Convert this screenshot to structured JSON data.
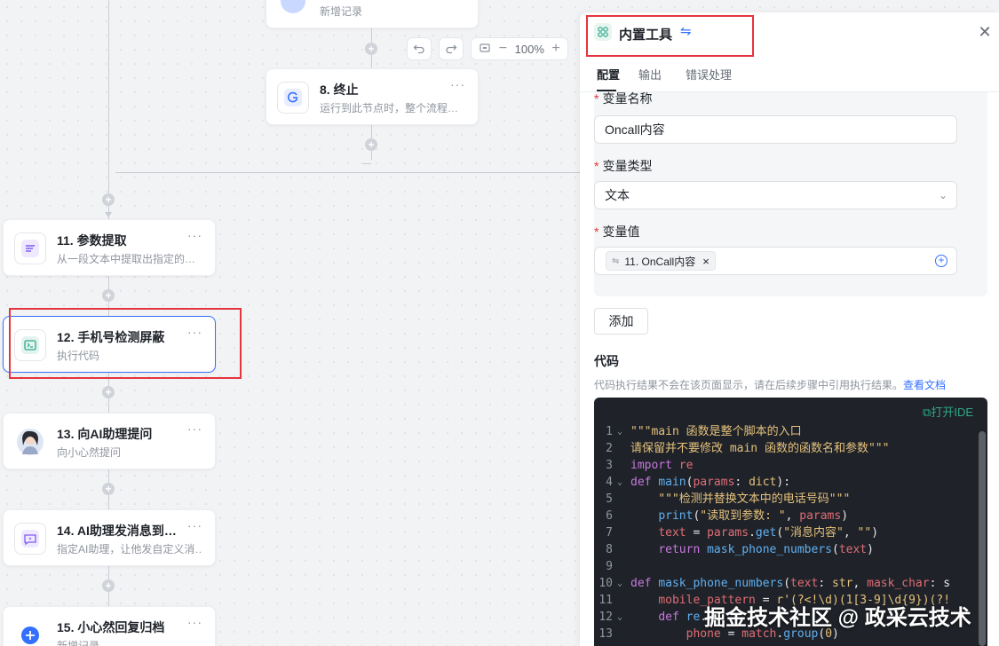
{
  "canvas": {
    "zoom": "100%",
    "nodes": [
      {
        "title": "",
        "desc": "新增记录",
        "icon": "blue-circle-icon"
      },
      {
        "title": "8. 终止",
        "desc": "运行到此节点时，整个流程…",
        "icon": "stop-refresh-icon"
      },
      {
        "title": "11. 参数提取",
        "desc": "从一段文本中提取出指定的…",
        "icon": "extract-lines-icon"
      },
      {
        "title": "12. 手机号检测屏蔽",
        "desc": "执行代码",
        "icon": "terminal-icon"
      },
      {
        "title": "13. 向AI助理提问",
        "desc": "向小心然提问",
        "icon": "avatar-icon"
      },
      {
        "title": "14. AI助理发消息到…",
        "desc": "指定AI助理，让他发自定义消…",
        "icon": "chat-sparkle-icon"
      },
      {
        "title": "15. 小心然回复归档",
        "desc": "新增记录",
        "icon": "add-record-icon"
      }
    ],
    "more": "···"
  },
  "panel": {
    "title": "内置工具",
    "tabs": [
      "配置",
      "输出",
      "错误处理"
    ],
    "var_name_label": "变量名称",
    "var_name_value": "Oncall内容",
    "var_type_label": "变量类型",
    "var_type_value": "文本",
    "var_value_label": "变量值",
    "var_value_chip": "11. OnCall内容",
    "add_button": "添加",
    "code_title": "代码",
    "code_note": "代码执行结果不会在该页面显示，请在后续步骤中引用执行结果。",
    "code_doc_link": "查看文档",
    "open_ide": "打开IDE",
    "code_lines": [
      {
        "n": "1",
        "fold": true
      },
      {
        "n": "2",
        "fold": false
      },
      {
        "n": "3",
        "fold": false
      },
      {
        "n": "4",
        "fold": true
      },
      {
        "n": "5",
        "fold": false
      },
      {
        "n": "6",
        "fold": false
      },
      {
        "n": "7",
        "fold": false
      },
      {
        "n": "8",
        "fold": false
      },
      {
        "n": "9",
        "fold": false
      },
      {
        "n": "10",
        "fold": true
      },
      {
        "n": "11",
        "fold": false
      },
      {
        "n": "12",
        "fold": true
      },
      {
        "n": "13",
        "fold": false
      }
    ]
  },
  "watermark": "掘金技术社区 @ 政采云技术",
  "colors": {
    "accent": "#3370ff",
    "highlight_box": "#e5343d",
    "code_bg": "#1f2329"
  }
}
